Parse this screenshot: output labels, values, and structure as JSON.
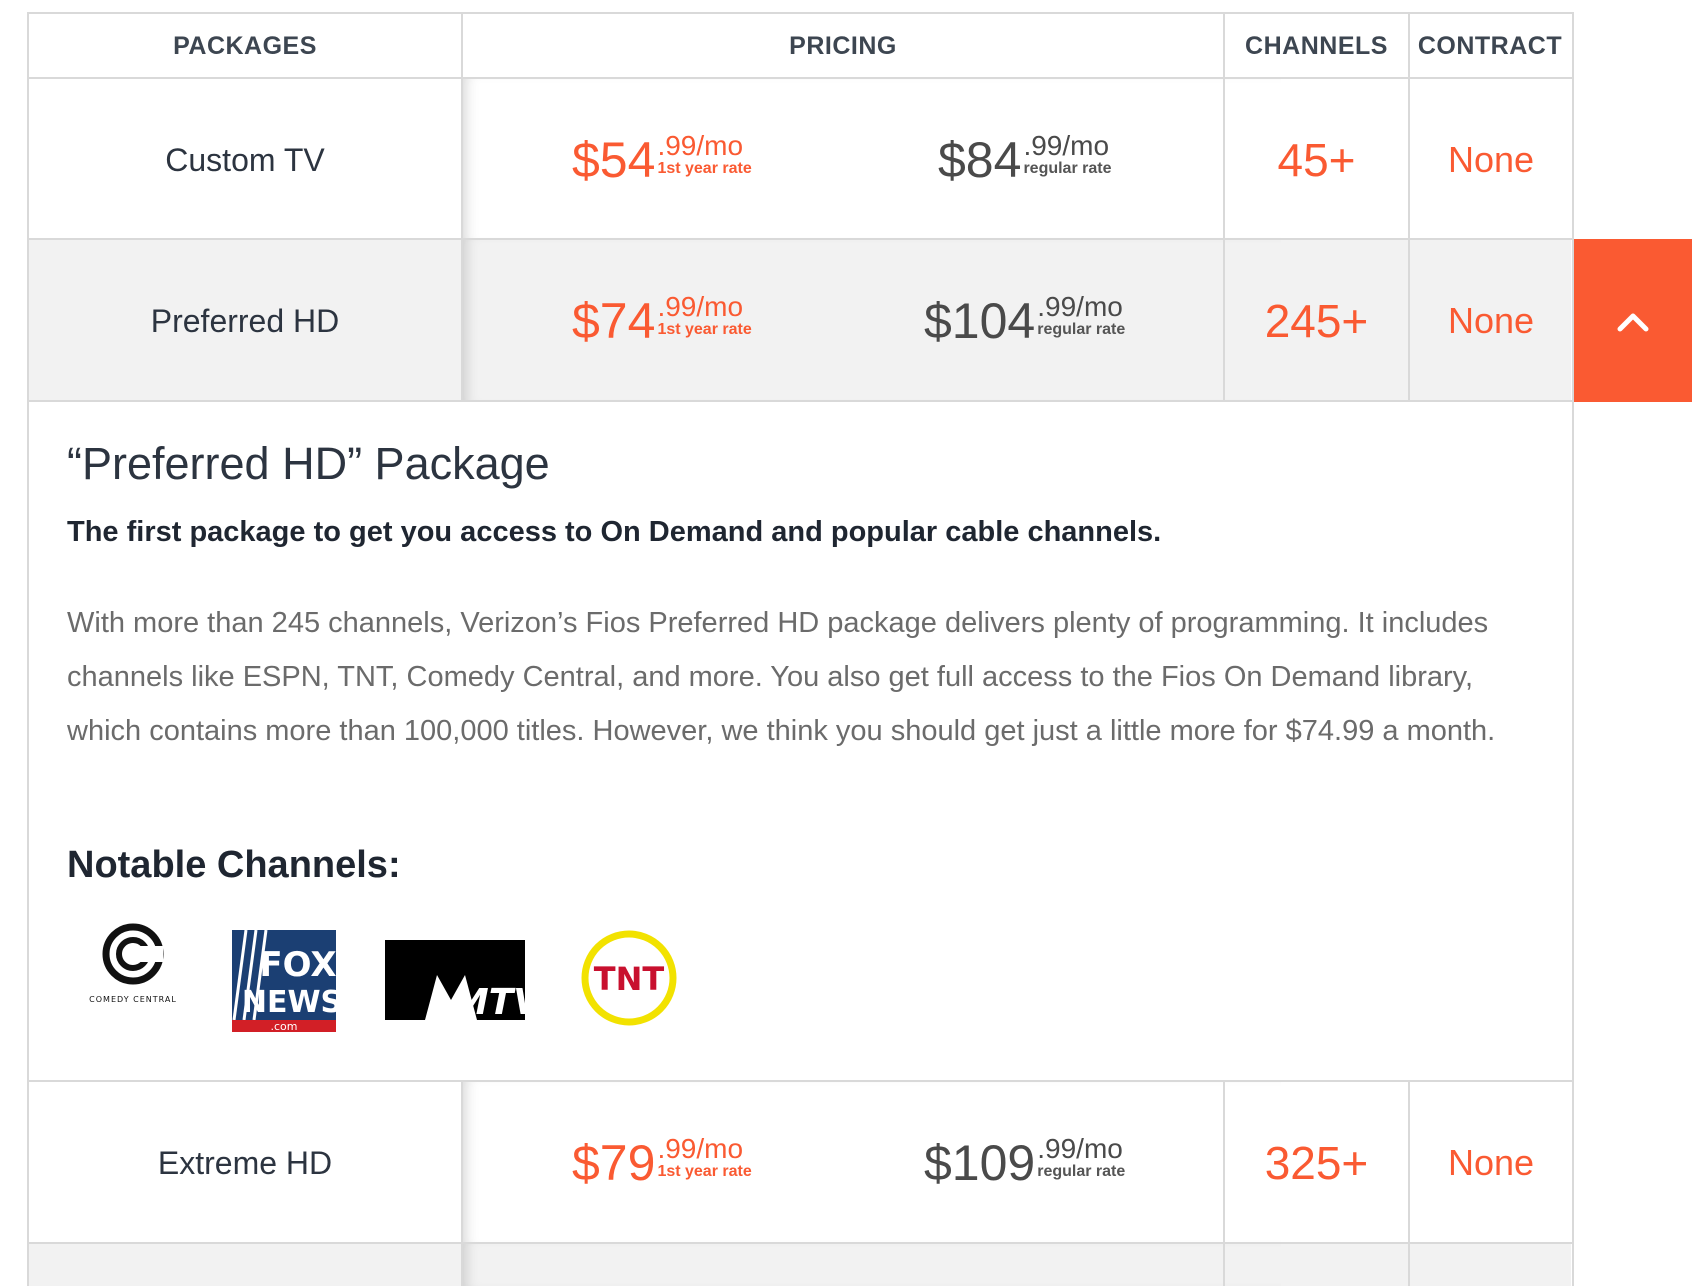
{
  "header": {
    "packages": "PACKAGES",
    "pricing": "PRICING",
    "channels": "CHANNELS",
    "contract": "CONTRACT"
  },
  "rows": [
    {
      "name": "Custom TV",
      "promo": {
        "dollars": "$54",
        "cents": ".99/mo",
        "note": "1st year rate"
      },
      "regular": {
        "dollars": "$84",
        "cents": ".99/mo",
        "note": "regular rate"
      },
      "channels": "45+",
      "contract": "None"
    },
    {
      "name": "Preferred HD",
      "promo": {
        "dollars": "$74",
        "cents": ".99/mo",
        "note": "1st year rate"
      },
      "regular": {
        "dollars": "$104",
        "cents": ".99/mo",
        "note": "regular rate"
      },
      "channels": "245+",
      "contract": "None"
    },
    {
      "name": "Extreme HD",
      "promo": {
        "dollars": "$79",
        "cents": ".99/mo",
        "note": "1st year rate"
      },
      "regular": {
        "dollars": "$109",
        "cents": ".99/mo",
        "note": "regular rate"
      },
      "channels": "325+",
      "contract": "None"
    }
  ],
  "detail": {
    "title": "“Preferred HD” Package",
    "subtitle": "The first package to get you access to On Demand and popular cable channels.",
    "body": "With more than 245 channels, Verizon’s Fios Preferred HD package delivers plenty of programming. It includes channels like ESPN, TNT, Comedy Central, and more. You also get full access to the Fios On Demand library, which contains more than 100,000 titles. However, we think you should get just a little more for $74.99 a month.",
    "notable_heading": "Notable Channels:",
    "logos": [
      {
        "icon": "comedy-central-logo",
        "text": "COMEDY CENTRAL"
      },
      {
        "icon": "fox-news-logo",
        "text1": "FOX",
        "text2": "NEWS",
        "text3": ".com"
      },
      {
        "icon": "mtv-logo",
        "text": "MTV"
      },
      {
        "icon": "tnt-logo",
        "text": "TNT"
      }
    ]
  },
  "toggle": {
    "icon": "chevron-up-icon"
  },
  "colors": {
    "accent": "#fa5a32",
    "text_dark": "#2c3440",
    "row_shade": "#f2f2f2"
  }
}
